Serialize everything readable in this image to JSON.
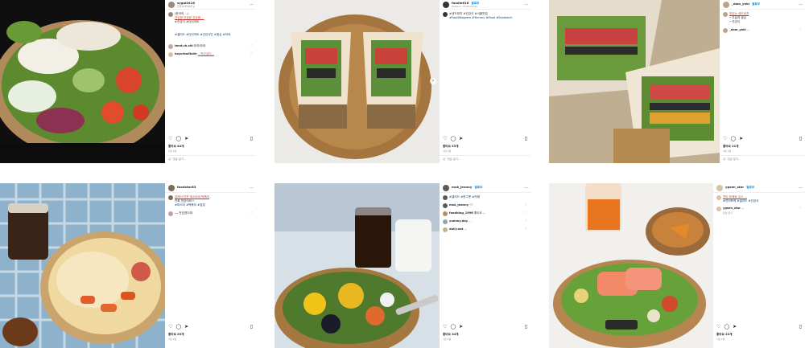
{
  "follow_label": "팔로우",
  "add_comment": "댓글 달기...",
  "reply_label": "답글 달기",
  "more_glyph": "···",
  "posts": [
    {
      "user": "sygal0416",
      "location": "한국외국어대학교",
      "caption": [
        "(한국의 ...)",
        "건강한 건강한 건강에 ...",
        "#건강식 #다이어트"
      ],
      "hashtags": "#샐러드 #다이어트 #건강식단 #점심 #저녁",
      "comments": [
        {
          "user": "tmnt.rb.ctt",
          "text": "😍😍😍😍"
        },
        {
          "user": "kayurkalitshh",
          "text": "...먹고싶다..."
        }
      ],
      "likes": "좋아요 44개",
      "date": "1월 1일"
    },
    {
      "user": "foodie616",
      "location": "Itaewon, South Korea",
      "caption": [
        "#샌드위치 #건강식 #서울맛집"
      ],
      "hashtags": "#FoodStagram #Yummy #Food #Sandwich",
      "comments": [],
      "likes": "좋아요 33개",
      "date": "1월 1일"
    },
    {
      "user": "_dam_yoki",
      "location": "",
      "caption": [
        "맛있는 샌드위치",
        "• 오늘의 점심",
        "• 건강식"
      ],
      "hashtags": "",
      "comments": [
        {
          "user": "_dam_yoki",
          "text": "..."
        }
      ],
      "likes": "좋아요 21개",
      "date": "1월 1일"
    },
    {
      "user": "foodstar83",
      "location": "",
      "caption": [
        "집에서 만든 파스타와 떡볶이",
        "진짜 맛있어요!!"
      ],
      "hashtags": "#파스타 #떡볶이 #집밥",
      "comments": [
        {
          "user": "...",
          "text": "맛있겠다😋"
        }
      ],
      "likes": "좋아요 29개",
      "date": "1월 1일"
    },
    {
      "user": "mok_jeonny",
      "location": "",
      "caption": [
        "#샐러드 #한그릇 #카페"
      ],
      "hashtags": "",
      "comments": [
        {
          "user": "mok_jeonny",
          "text": "🤍"
        },
        {
          "user": "foodblog_1996",
          "text": "좋아요 ..."
        },
        {
          "user": "yummy.day",
          "text": "..."
        },
        {
          "user": "daily.eat",
          "text": "..."
        }
      ],
      "likes": "좋아요 34개",
      "date": "1월 1일"
    },
    {
      "user": "ygsen_star",
      "location": "",
      "caption": [
        "연어 포케와 주스 ..."
      ],
      "hashtags": "#연어포케 #샐러드 #건강식",
      "comments": [
        {
          "user": "ygsen_star",
          "text": "..."
        }
      ],
      "likes": "좋아요 22개",
      "date": "1월 1일"
    }
  ]
}
